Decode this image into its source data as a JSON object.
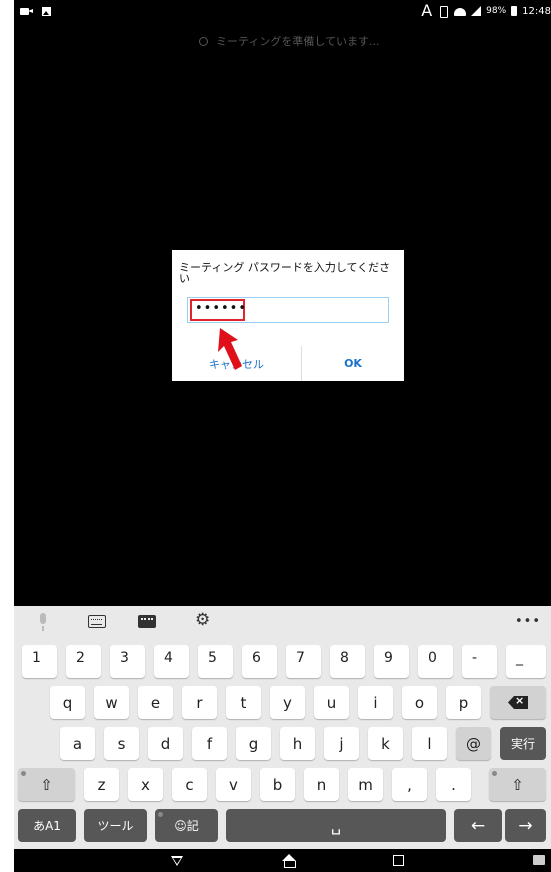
{
  "status_bar": {
    "a_glyph": "A",
    "battery_percent": "98%",
    "time": "12:48",
    "icons": [
      "video-icon",
      "image-icon",
      "vibrate-icon",
      "wifi-icon",
      "signal-icon",
      "battery-icon"
    ]
  },
  "meeting": {
    "preparing_text": "ミーティングを準備しています..."
  },
  "dialog": {
    "title": "ミーティング パスワードを入力してください",
    "password_value": "••••••",
    "cancel_label": "キャンセル",
    "ok_label": "OK",
    "highlight_color": "#e0242c",
    "arrow_color": "#e0101a"
  },
  "keyboard": {
    "toolbar": {
      "icons": [
        "mic-icon",
        "keyboard-switch-icon",
        "keyboard-icon",
        "gear-icon",
        "more-icon"
      ],
      "more_label": "•••"
    },
    "row1": [
      "1",
      "2",
      "3",
      "4",
      "5",
      "6",
      "7",
      "8",
      "9",
      "0",
      "-",
      "_"
    ],
    "row2": [
      "q",
      "w",
      "e",
      "r",
      "t",
      "y",
      "u",
      "i",
      "o",
      "p"
    ],
    "row3": [
      "a",
      "s",
      "d",
      "f",
      "g",
      "h",
      "j",
      "k",
      "l",
      "@"
    ],
    "enter_label": "実行",
    "row4": [
      "z",
      "x",
      "c",
      "v",
      "b",
      "n",
      "m",
      ",",
      "."
    ],
    "shift_label": "⇧",
    "mode_label": "あA1",
    "tool_label": "ツール",
    "emoji_label": "☺記",
    "space_label": "␣",
    "left_label": "←",
    "right_label": "→"
  },
  "nav_bar": {
    "icons": [
      "back-icon",
      "home-icon",
      "recents-icon",
      "keyboard-hide-icon"
    ]
  }
}
